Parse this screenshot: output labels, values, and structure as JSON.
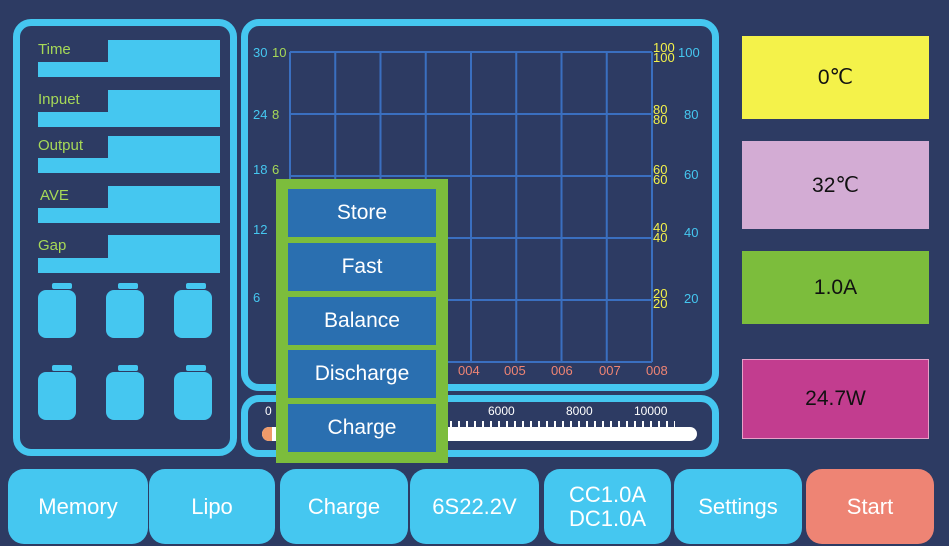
{
  "stats": {
    "time_label": "Time",
    "input_label": "Inpuet",
    "output_label": "Output",
    "ave_label": "AVE",
    "gap_label": "Gap"
  },
  "chart_data": {
    "type": "line",
    "left_axis_outer": [
      "30",
      "24",
      "18",
      "12",
      "6"
    ],
    "left_axis_inner": [
      "10",
      "8",
      "6"
    ],
    "right_axis_inner": [
      "100",
      "80",
      "60",
      "40",
      "20"
    ],
    "right_axis_inner_sub": [
      "100",
      "80",
      "60",
      "40",
      "20"
    ],
    "right_axis_outer": [
      "100",
      "80",
      "60",
      "40",
      "20"
    ],
    "x_axis": [
      "004",
      "005",
      "006",
      "007",
      "008"
    ],
    "grid": true,
    "series": []
  },
  "progress": {
    "start_label": "0",
    "labels": [
      "6000",
      "8000",
      "10000"
    ],
    "value_fraction": 0.0
  },
  "mode_menu": [
    "Store",
    "Fast",
    "Balance",
    "Discharge",
    "Charge"
  ],
  "gauges": {
    "temp1": "0℃",
    "temp2": "32℃",
    "current": "1.0A",
    "power": "24.7W"
  },
  "bottom": {
    "memory": "Memory",
    "lipo": "Lipo",
    "charge": "Charge",
    "voltage": "6S22.2V",
    "cc": "CC1.0A",
    "dc": "DC1.0A",
    "settings": "Settings",
    "start": "Start"
  },
  "colors": {
    "background": "#2d3b63",
    "accent": "#45c7f0",
    "grid": "#3a6fc0",
    "menu_border": "#7cbd3c",
    "menu_item": "#2a6fb0",
    "gauge_yellow": "#f4f24a",
    "gauge_lilac": "#d3acd4",
    "gauge_green": "#7cbd3c",
    "gauge_magenta": "#c23d8f",
    "start": "#ee8474"
  }
}
